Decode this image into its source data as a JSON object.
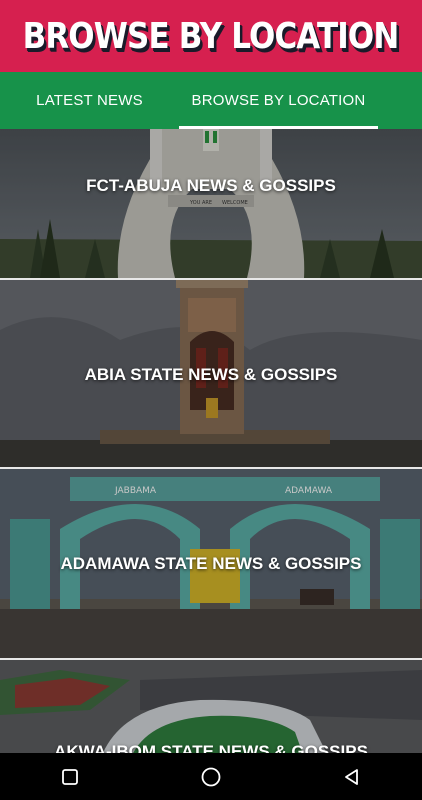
{
  "header": {
    "title": "BROWSE BY LOCATION"
  },
  "tabs": [
    {
      "label": "LATEST NEWS",
      "active": false
    },
    {
      "label": "BROWSE BY LOCATION",
      "active": true
    }
  ],
  "cards": [
    {
      "title": "FCT-ABUJA NEWS & GOSSIPS",
      "gate_text_left": "YOU ARE",
      "gate_text_right": "WELCOME"
    },
    {
      "title": "ABIA STATE NEWS & GOSSIPS"
    },
    {
      "title": "ADAMAWA STATE NEWS & GOSSIPS",
      "sign_text_left": "JABBAMA",
      "sign_text_right": "ADAMAWA"
    },
    {
      "title": "AKWA-IBOM STATE NEWS & GOSSIPS"
    }
  ],
  "colors": {
    "header": "#d6204f",
    "tabs": "#17924a",
    "navbar": "#000000"
  },
  "navbar": {
    "icons": [
      "square-icon",
      "circle-icon",
      "triangle-back-icon"
    ]
  }
}
